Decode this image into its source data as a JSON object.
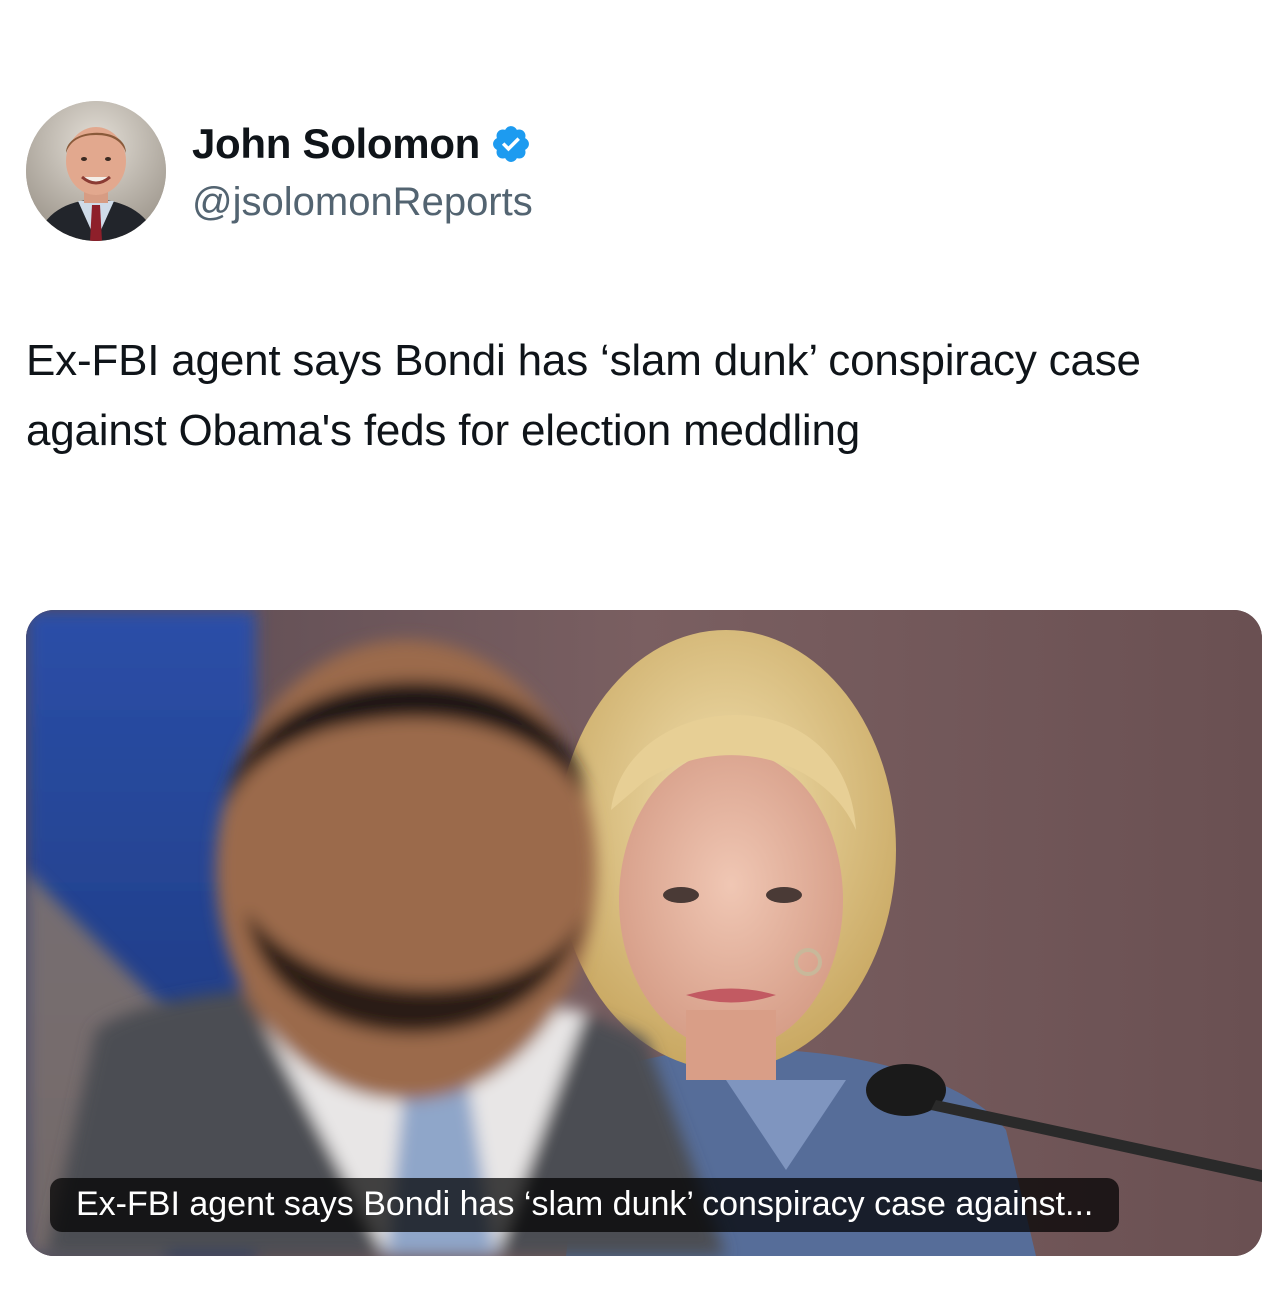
{
  "author": {
    "display_name": "John Solomon",
    "handle": "@jsolomonReports",
    "verified": true,
    "avatar_icon": "profile-photo",
    "verified_icon": "verified-badge-icon",
    "verified_color": "#1d9bf0"
  },
  "tweet": {
    "text": "Ex-FBI agent says Bondi has ‘slam dunk’ conspiracy case against Obama's feds for election meddling"
  },
  "media": {
    "caption": "Ex-FBI agent says Bondi has ‘slam dunk’ conspiracy case against..."
  },
  "colors": {
    "text_primary": "#0f1419",
    "text_secondary": "#536471",
    "background": "#ffffff"
  }
}
